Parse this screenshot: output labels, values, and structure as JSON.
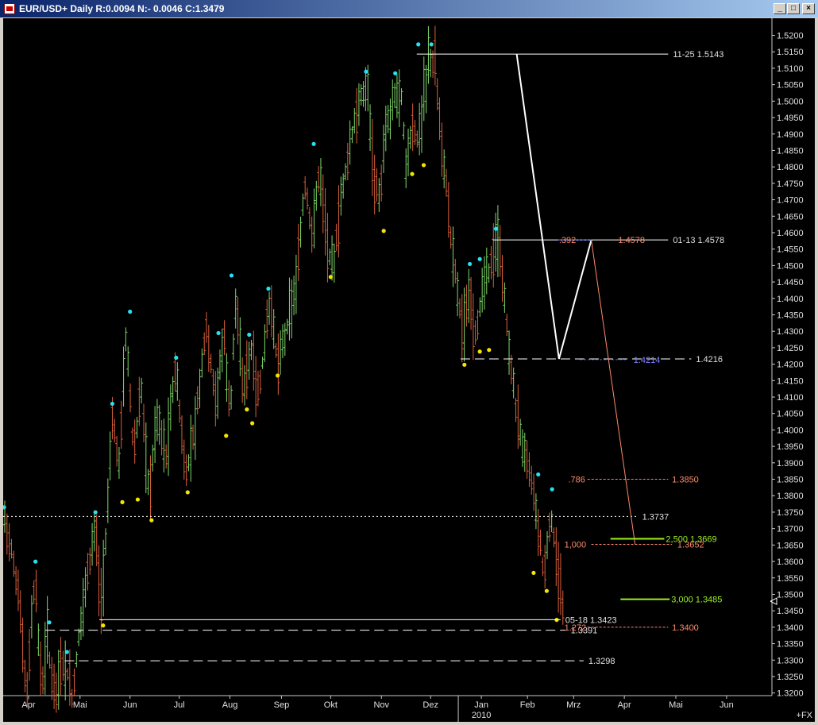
{
  "window": {
    "title": "EUR/USD+ Daily R:0.0094 N:- 0.0046 C:1.3479",
    "minimize": "_",
    "maximize": "□",
    "close": "×"
  },
  "colors": {
    "background": "#000000",
    "up_bar": "#7fd96a",
    "down_bar": "#d9603c",
    "swing_high": "#27e0f0",
    "swing_low": "#f5e300",
    "pattern_line": "#ffffff",
    "fib_line": "#ff8a6a",
    "target_line": "#9cf020"
  },
  "chart_data": {
    "type": "ohlc",
    "instrument": "EUR/USD+",
    "timeframe": "Daily",
    "ylim": [
      1.3192,
      1.5252
    ],
    "y_ticks": [
      1.52,
      1.515,
      1.51,
      1.505,
      1.5,
      1.495,
      1.49,
      1.485,
      1.48,
      1.475,
      1.47,
      1.465,
      1.46,
      1.455,
      1.45,
      1.445,
      1.44,
      1.435,
      1.43,
      1.425,
      1.42,
      1.415,
      1.41,
      1.405,
      1.4,
      1.395,
      1.39,
      1.385,
      1.38,
      1.375,
      1.37,
      1.365,
      1.36,
      1.355,
      1.35,
      1.345,
      1.34,
      1.335,
      1.33,
      1.325,
      1.32
    ],
    "x_axis": {
      "months": [
        {
          "label": "Apr",
          "pos": 0.033
        },
        {
          "label": "Mai",
          "pos": 0.1
        },
        {
          "label": "Jun",
          "pos": 0.165
        },
        {
          "label": "Jul",
          "pos": 0.229
        },
        {
          "label": "Aug",
          "pos": 0.295
        },
        {
          "label": "Sep",
          "pos": 0.362
        },
        {
          "label": "Okt",
          "pos": 0.426
        },
        {
          "label": "Nov",
          "pos": 0.492
        },
        {
          "label": "Dez",
          "pos": 0.556
        },
        {
          "label": "Jan",
          "pos": 0.622
        },
        {
          "label": "Feb",
          "pos": 0.682
        },
        {
          "label": "Mrz",
          "pos": 0.742
        },
        {
          "label": "Apr",
          "pos": 0.808
        },
        {
          "label": "Mai",
          "pos": 0.875
        },
        {
          "label": "Jun",
          "pos": 0.941
        }
      ],
      "year_label": "2010",
      "year_pos": 0.622,
      "year_divider_pos": 0.592,
      "corner_label": "+FX"
    },
    "price_path": [
      [
        0.0,
        1.374
      ],
      [
        0.01,
        1.362
      ],
      [
        0.02,
        1.345
      ],
      [
        0.025,
        1.328
      ],
      [
        0.03,
        1.322
      ],
      [
        0.035,
        1.343
      ],
      [
        0.04,
        1.355
      ],
      [
        0.045,
        1.33
      ],
      [
        0.05,
        1.322
      ],
      [
        0.055,
        1.34
      ],
      [
        0.06,
        1.325
      ],
      [
        0.068,
        1.322
      ],
      [
        0.078,
        1.33
      ],
      [
        0.088,
        1.318
      ],
      [
        0.1,
        1.345
      ],
      [
        0.11,
        1.36
      ],
      [
        0.118,
        1.373
      ],
      [
        0.124,
        1.345
      ],
      [
        0.13,
        1.36
      ],
      [
        0.14,
        1.405
      ],
      [
        0.148,
        1.388
      ],
      [
        0.158,
        1.43
      ],
      [
        0.168,
        1.392
      ],
      [
        0.178,
        1.412
      ],
      [
        0.188,
        1.38
      ],
      [
        0.198,
        1.405
      ],
      [
        0.21,
        1.392
      ],
      [
        0.222,
        1.42
      ],
      [
        0.235,
        1.385
      ],
      [
        0.248,
        1.402
      ],
      [
        0.262,
        1.432
      ],
      [
        0.275,
        1.408
      ],
      [
        0.285,
        1.43
      ],
      [
        0.293,
        1.403
      ],
      [
        0.3,
        1.44
      ],
      [
        0.31,
        1.412
      ],
      [
        0.32,
        1.425
      ],
      [
        0.33,
        1.41
      ],
      [
        0.345,
        1.44
      ],
      [
        0.355,
        1.42
      ],
      [
        0.368,
        1.432
      ],
      [
        0.38,
        1.445
      ],
      [
        0.39,
        1.475
      ],
      [
        0.4,
        1.46
      ],
      [
        0.41,
        1.48
      ],
      [
        0.42,
        1.455
      ],
      [
        0.428,
        1.45
      ],
      [
        0.44,
        1.475
      ],
      [
        0.452,
        1.49
      ],
      [
        0.462,
        1.5
      ],
      [
        0.472,
        1.505
      ],
      [
        0.48,
        1.478
      ],
      [
        0.488,
        1.47
      ],
      [
        0.495,
        1.49
      ],
      [
        0.505,
        1.5
      ],
      [
        0.515,
        1.505
      ],
      [
        0.522,
        1.48
      ],
      [
        0.53,
        1.492
      ],
      [
        0.538,
        1.488
      ],
      [
        0.545,
        1.5
      ],
      [
        0.552,
        1.514
      ],
      [
        0.56,
        1.51
      ],
      [
        0.565,
        1.495
      ],
      [
        0.572,
        1.48
      ],
      [
        0.58,
        1.46
      ],
      [
        0.588,
        1.445
      ],
      [
        0.596,
        1.43
      ],
      [
        0.605,
        1.44
      ],
      [
        0.614,
        1.428
      ],
      [
        0.622,
        1.445
      ],
      [
        0.632,
        1.45
      ],
      [
        0.642,
        1.458
      ],
      [
        0.65,
        1.44
      ],
      [
        0.658,
        1.42
      ],
      [
        0.666,
        1.405
      ],
      [
        0.675,
        1.395
      ],
      [
        0.685,
        1.385
      ],
      [
        0.694,
        1.37
      ],
      [
        0.702,
        1.355
      ],
      [
        0.71,
        1.375
      ],
      [
        0.718,
        1.36
      ],
      [
        0.726,
        1.345
      ]
    ],
    "swing_highs": [
      [
        0.001,
        1.3755
      ],
      [
        0.042,
        1.359
      ],
      [
        0.06,
        1.3405
      ],
      [
        0.083,
        1.3315
      ],
      [
        0.12,
        1.374
      ],
      [
        0.142,
        1.407
      ],
      [
        0.165,
        1.435
      ],
      [
        0.225,
        1.421
      ],
      [
        0.28,
        1.4285
      ],
      [
        0.297,
        1.446
      ],
      [
        0.32,
        1.428
      ],
      [
        0.345,
        1.442
      ],
      [
        0.404,
        1.486
      ],
      [
        0.472,
        1.508
      ],
      [
        0.51,
        1.5075
      ],
      [
        0.54,
        1.5163
      ],
      [
        0.557,
        1.5163
      ],
      [
        0.641,
        1.4602
      ],
      [
        0.607,
        1.4495
      ],
      [
        0.62,
        1.451
      ],
      [
        0.696,
        1.3855
      ],
      [
        0.714,
        1.381
      ]
    ],
    "swing_lows": [
      [
        0.13,
        1.3415
      ],
      [
        0.155,
        1.379
      ],
      [
        0.175,
        1.3798
      ],
      [
        0.193,
        1.3735
      ],
      [
        0.24,
        1.382
      ],
      [
        0.29,
        1.3992
      ],
      [
        0.317,
        1.4072
      ],
      [
        0.324,
        1.403
      ],
      [
        0.357,
        1.4175
      ],
      [
        0.426,
        1.4475
      ],
      [
        0.495,
        1.4615
      ],
      [
        0.532,
        1.4788
      ],
      [
        0.547,
        1.4815
      ],
      [
        0.6,
        1.4208
      ],
      [
        0.62,
        1.4248
      ],
      [
        0.632,
        1.4253
      ],
      [
        0.69,
        1.3575
      ],
      [
        0.707,
        1.352
      ],
      [
        0.72,
        1.3432
      ]
    ],
    "horizontal_lines": [
      {
        "label": "11-25  1.5143",
        "value": 1.5143,
        "x0": 0.538,
        "x1": 0.865,
        "style": "solid",
        "color": "#ffffff"
      },
      {
        "label": "01-13  1.4578",
        "value": 1.4578,
        "x0": 0.637,
        "x1": 0.865,
        "style": "solid",
        "color": "#ffffff"
      },
      {
        "label": "1.4216",
        "value": 1.4216,
        "x0": 0.595,
        "x1": 0.895,
        "style": "longdash",
        "color": "#ffffff"
      },
      {
        "label": "1.3737",
        "value": 1.3737,
        "x0": 0.0,
        "x1": 0.825,
        "style": "dotted",
        "color": "#ffffff"
      },
      {
        "label": "05-18  1.3423",
        "value": 1.3423,
        "x0": 0.125,
        "x1": 0.725,
        "style": "solid",
        "color": "#ffffff"
      },
      {
        "label": "1.3391",
        "value": 1.3391,
        "x0": 0.055,
        "x1": 0.732,
        "style": "longdash",
        "color": "#ffffff"
      },
      {
        "label": "1.3298",
        "value": 1.3298,
        "x0": 0.08,
        "x1": 0.755,
        "style": "longdash",
        "color": "#ffffff"
      }
    ],
    "pattern_lines": [
      {
        "points": [
          [
            0.668,
            1.5143
          ],
          [
            0.723,
            1.4216
          ],
          [
            0.765,
            1.4578
          ]
        ],
        "color": "#ffffff",
        "width": 2
      },
      {
        "points": [
          [
            0.765,
            1.4578
          ],
          [
            0.822,
            1.3652
          ]
        ],
        "color": "#ff8a6a",
        "width": 1
      }
    ],
    "fib_levels": [
      {
        "ratio": ".392",
        "ratio_label_x": 0.723,
        "value_label": "1.4578",
        "value": 1.4578,
        "x0": 0.722,
        "x1": 0.765,
        "color": "#4060ff",
        "label_color": "#ff8a6a",
        "value_label_x": 0.8
      },
      {
        "ratio": "",
        "ratio_label_x": 0.0,
        "value_label": "1.4214",
        "value": 1.4214,
        "x0": 0.75,
        "x1": 0.81,
        "color": "#4060ff",
        "label_color": "#8080ff",
        "value_label_x": 0.82
      },
      {
        "ratio": ".786",
        "ratio_label_x": 0.735,
        "value_label": "1.3850",
        "value": 1.385,
        "x0": 0.76,
        "x1": 0.865,
        "color": "#ff8a6a",
        "label_color": "#ff8a6a",
        "value_label_x": 0.87
      },
      {
        "ratio": "1,000",
        "ratio_label_x": 0.73,
        "value_label": "1.3652",
        "value": 1.3652,
        "x0": 0.765,
        "x1": 0.87,
        "color": "#ff8a6a",
        "label_color": "#ff8a6a",
        "value_label_x": 0.877
      },
      {
        "ratio": "1.272",
        "ratio_label_x": 0.73,
        "value_label": "1.3400",
        "value": 1.34,
        "x0": 0.76,
        "x1": 0.865,
        "color": "#ff8a6a",
        "label_color": "#ff8a6a",
        "value_label_x": 0.87
      }
    ],
    "target_levels": [
      {
        "ratio": "2,500",
        "value_label": "1.3669",
        "value": 1.3669,
        "x0": 0.79,
        "x1": 0.86,
        "color": "#9cf020",
        "label_x": 0.862
      },
      {
        "ratio": "3,000",
        "value_label": "1.3485",
        "value": 1.3485,
        "x0": 0.803,
        "x1": 0.867,
        "color": "#9cf020",
        "label_x": 0.869
      }
    ],
    "current_price_marker": 1.3479
  }
}
